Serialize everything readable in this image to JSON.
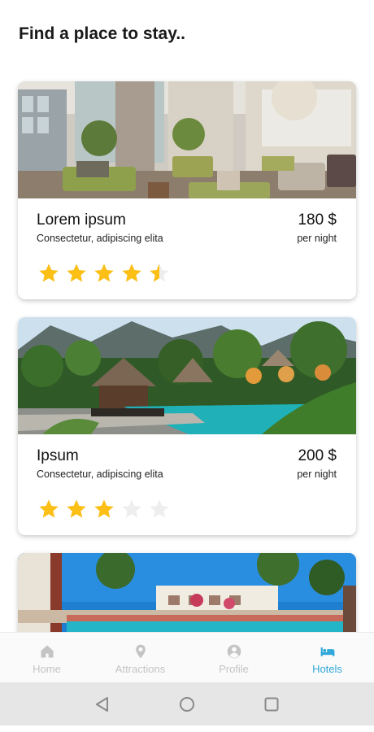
{
  "page": {
    "title": "Find a place to stay.."
  },
  "hotels": [
    {
      "name": "Lorem ipsum",
      "description": "Consectetur, adipiscing elita",
      "price": "180 $",
      "price_unit": "per night",
      "rating": 4.5,
      "max_rating": 5,
      "image": "hotel-lobby-image"
    },
    {
      "name": "Ipsum",
      "description": "Consectetur, adipiscing elita",
      "price": "200 $",
      "price_unit": "per night",
      "rating": 3,
      "max_rating": 5,
      "image": "tropical-pool-image"
    },
    {
      "image": "beach-resort-image"
    }
  ],
  "nav": {
    "items": [
      {
        "label": "Home",
        "icon": "home-icon",
        "active": false
      },
      {
        "label": "Attractions",
        "icon": "map-pin-icon",
        "active": false
      },
      {
        "label": "Profile",
        "icon": "profile-icon",
        "active": false
      },
      {
        "label": "Hotels",
        "icon": "bed-icon",
        "active": true
      }
    ]
  },
  "colors": {
    "accent": "#2ea8d9",
    "star_filled": "#fbbf16",
    "star_empty": "#eeeeee",
    "nav_inactive": "#c4c4c4"
  }
}
